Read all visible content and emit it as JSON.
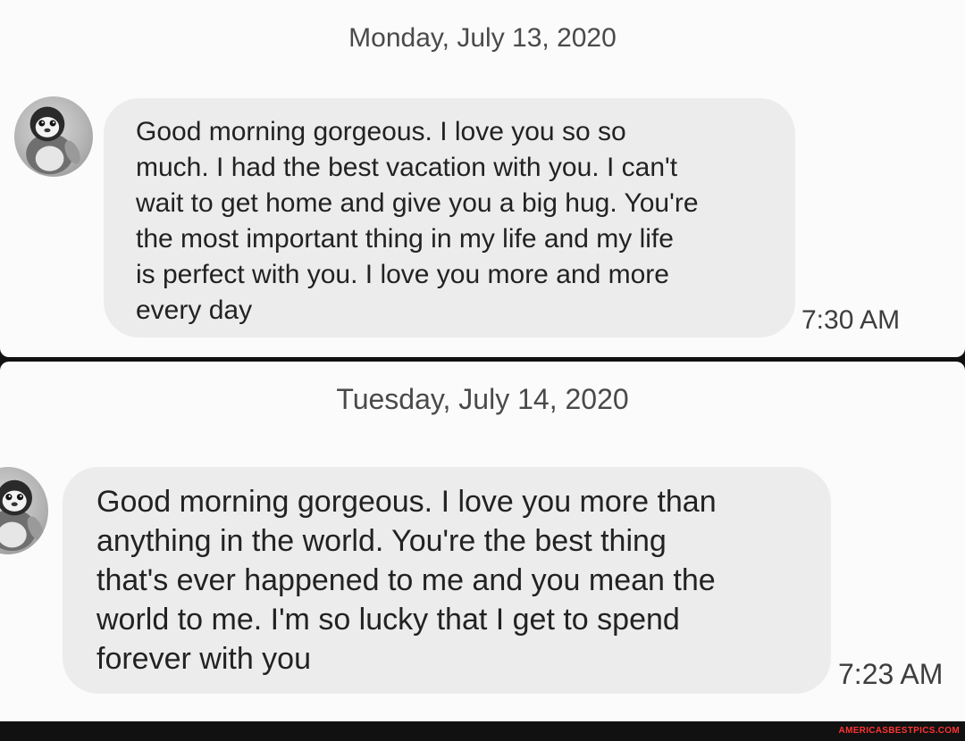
{
  "conversations": [
    {
      "date": "Monday, July 13, 2020",
      "message_lines": [
        "Good morning gorgeous. I love you so so",
        "much. I had the best vacation with you. I can't",
        "wait to get home and give you a big hug. You're",
        "the most important thing in my life and my life",
        "is perfect with you. I love you more and more",
        "every day"
      ],
      "time": "7:30 AM",
      "avatar_icon": "penguin-avatar-icon"
    },
    {
      "date": "Tuesday, July 14, 2020",
      "message_lines": [
        "Good morning gorgeous. I love you more than",
        "anything in the world. You're the best thing",
        "that's ever happened to me and you mean the",
        "world to me. I'm so lucky that I get to spend",
        "forever with you"
      ],
      "time": "7:23 AM",
      "avatar_icon": "penguin-avatar-icon"
    }
  ],
  "watermark": "AMERICASBESTPICS.COM",
  "colors": {
    "panel_background": "#fbfbfb",
    "bubble_background": "#ececec",
    "divider": "#111111",
    "watermark": "#ff3333"
  }
}
